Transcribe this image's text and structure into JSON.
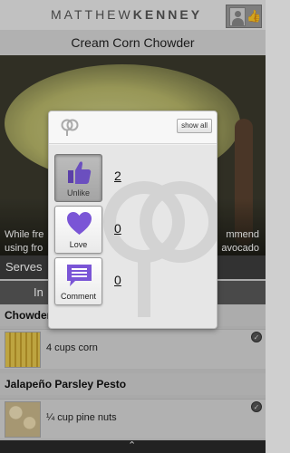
{
  "header": {
    "brand_first": "MATTHEW",
    "brand_second": "KENNEY"
  },
  "recipe": {
    "title": "Cream Corn Chowder",
    "caption_left": "While fre",
    "caption_right": "mmend",
    "caption2_left": "using fro",
    "caption2_right": "avocado",
    "serves_label": "Serves",
    "tab_label": "In"
  },
  "ingredients": {
    "sections": [
      {
        "title": "Chowder",
        "items": [
          {
            "text": "4 cups corn"
          }
        ]
      },
      {
        "title": "Jalapeño Parsley Pesto",
        "items": [
          {
            "text": "¼ cup pine nuts"
          }
        ]
      }
    ]
  },
  "popup": {
    "show_all_label": "show all",
    "reactions": [
      {
        "label": "Unlike",
        "count": "2",
        "icon": "thumbs-up-icon",
        "active": true
      },
      {
        "label": "Love",
        "count": "0",
        "icon": "heart-icon",
        "active": false
      },
      {
        "label": "Comment",
        "count": "0",
        "icon": "comment-icon",
        "active": false
      }
    ],
    "accent": "#6b4fbf"
  }
}
